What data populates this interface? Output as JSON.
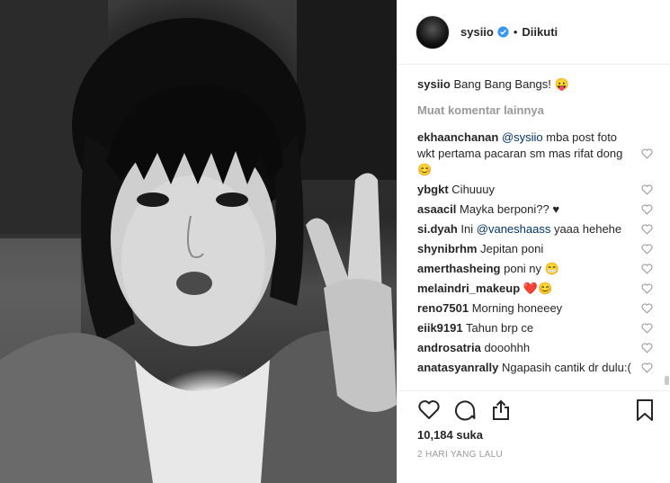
{
  "post": {
    "username": "sysiio",
    "follow_status": "Diikuti",
    "separator": "•",
    "caption_user": "sysiio",
    "caption_text": "Bang Bang Bangs! 😛",
    "load_more": "Muat komentar lainnya",
    "likes": "10,184 suka",
    "time": "2 HARI YANG LALU"
  },
  "comments": [
    {
      "user": "ekhaanchanan",
      "mention": "@sysiio",
      "text": " mba post foto wkt pertama pacaran sm mas rifat dong😊"
    },
    {
      "user": "ybgkt",
      "mention": "",
      "text": "Cihuuuy"
    },
    {
      "user": "asaacil",
      "mention": "",
      "text": "Mayka berponi?? ♥"
    },
    {
      "user": "si.dyah",
      "mention": "@vaneshaass",
      "text": " yaaa hehehe",
      "prefix": "Ini "
    },
    {
      "user": "shynibrhm",
      "mention": "",
      "text": "Jepitan poni"
    },
    {
      "user": "amerthasheing",
      "mention": "",
      "text": "poni ny 😁"
    },
    {
      "user": "melaindri_makeup",
      "mention": "",
      "text": "❤️😊"
    },
    {
      "user": "reno7501",
      "mention": "",
      "text": "Morning honeeey"
    },
    {
      "user": "eiik9191",
      "mention": "",
      "text": "Tahun brp ce"
    },
    {
      "user": "androsatria",
      "mention": "",
      "text": "dooohhh"
    },
    {
      "user": "anatasyanrally",
      "mention": "",
      "text": "Ngapasih cantik dr dulu:("
    }
  ],
  "icons": {
    "like": "heart-icon",
    "comment": "comment-icon",
    "share": "share-icon",
    "save": "bookmark-icon",
    "verified": "verified-badge-icon"
  },
  "colors": {
    "verified": "#3897f0",
    "mention": "#003569",
    "muted": "#999999",
    "border": "#efefef"
  }
}
